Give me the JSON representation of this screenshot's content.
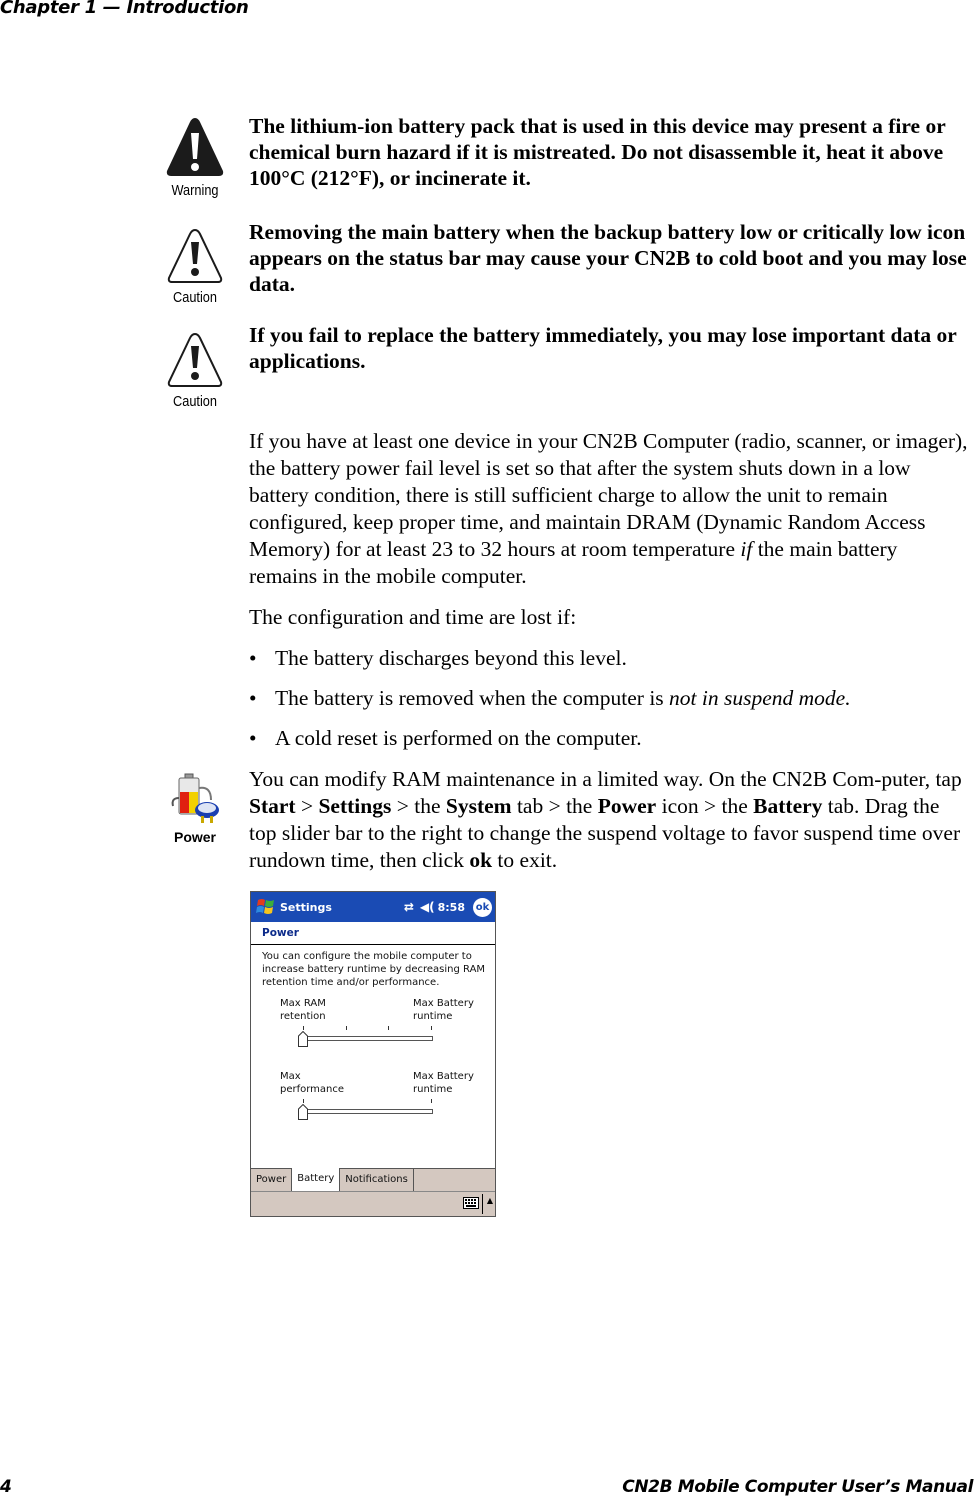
{
  "header": {
    "chapter": "Chapter 1 — Introduction"
  },
  "notices": [
    {
      "type": "warning",
      "icon_label": "Warning",
      "icon": "warning-triangle-filled-icon",
      "text": "The lithium-ion battery pack that is used in this device may present a fire or chemical burn hazard if it is mistreated. Do not disassemble it, heat it above 100°C (212°F), or incinerate it."
    },
    {
      "type": "caution",
      "icon_label": "Caution",
      "icon": "caution-triangle-icon",
      "text": "Removing the main battery when the backup battery low or critically low icon appears on the status bar may cause your CN2B to cold boot and you may lose data."
    },
    {
      "type": "caution",
      "icon_label": "Caution",
      "icon": "caution-triangle-icon",
      "text": "If you fail to replace the battery immediately, you may lose important data or applications."
    }
  ],
  "body": {
    "para1_a": "If you have at least one device in your CN2B Computer (radio, scanner, or imager), the battery power fail level is set so that after the system shuts down in a low battery condition, there is still sufficient charge to allow the unit to remain configured, keep proper time, and maintain DRAM (Dynamic Random Access Memory) for at least 23 to 32 hours at room temperature ",
    "para1_em": "if",
    "para1_b": " the main battery remains in the mobile computer.",
    "para2": "The configuration and time are lost if:",
    "bullets": [
      {
        "text": "The battery discharges beyond this level.",
        "em": ""
      },
      {
        "text": "The battery is removed when the computer is ",
        "em": "not in suspend mode."
      },
      {
        "text": "A cold reset is performed on the computer.",
        "em": ""
      }
    ],
    "bullet_char": "•",
    "power_icon_label": "Power",
    "para3": {
      "t1": "You can modify RAM maintenance in a limited way. On the CN2B Com-puter, tap ",
      "b1": "Start",
      "t2": " > ",
      "b2": "Settings",
      "t3": " > the ",
      "b3": "System",
      "t4": " tab > the ",
      "b4": "Power",
      "t5": " icon > the ",
      "b5": "Battery",
      "t6": " tab. Drag the top slider bar to the right to change the suspend voltage to favor suspend time over rundown time, then click ",
      "b6": "ok",
      "t7": " to exit."
    }
  },
  "screenshot": {
    "title": "Settings",
    "sync_icon": "⇄",
    "volume_icon": "◀(",
    "time": "8:58",
    "ok_label": "ok",
    "subtitle": "Power",
    "description": "You can configure the mobile computer to increase battery runtime by decreasing RAM retention time and/or performance.",
    "slider1": {
      "left_label": "Max RAM retention",
      "right_label": "Max Battery runtime",
      "value_fraction": 0.0,
      "ticks": 4
    },
    "slider2": {
      "left_label": "Max performance",
      "right_label": "Max Battery runtime",
      "value_fraction": 0.0,
      "ticks": 2
    },
    "tabs": [
      {
        "label": "Power",
        "active": false
      },
      {
        "label": "Battery",
        "active": true
      },
      {
        "label": "Notifications",
        "active": false
      }
    ],
    "colors": {
      "titlebar": "#1a4bb4",
      "subtitle": "#0b2a8a",
      "tabbar": "#d4c8c0"
    }
  },
  "footer": {
    "page_number": "4",
    "manual_title": "CN2B Mobile Computer User’s Manual"
  }
}
